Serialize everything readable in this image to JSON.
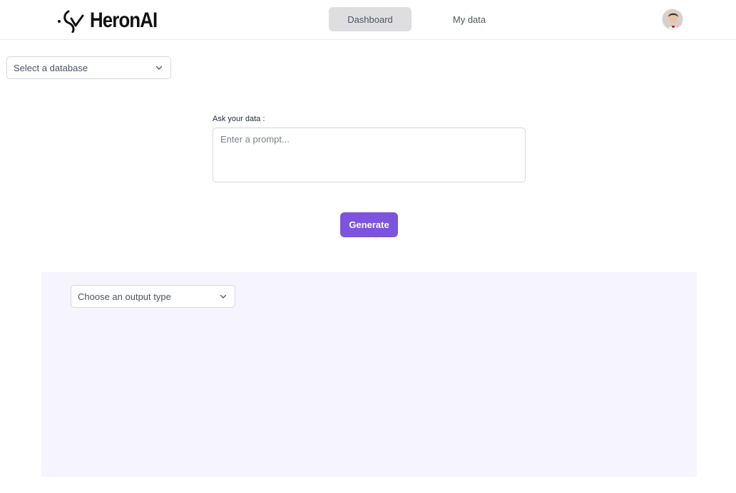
{
  "header": {
    "logo_text": "HeronAI",
    "nav": {
      "dashboard_label": "Dashboard",
      "my_data_label": "My data"
    },
    "active_tab": "Dashboard"
  },
  "database_select": {
    "placeholder": "Select a database"
  },
  "prompt": {
    "label": "Ask your data :",
    "placeholder": "Enter a prompt...",
    "value": ""
  },
  "generate_button": {
    "label": "Generate"
  },
  "output": {
    "type_select_placeholder": "Choose an output type"
  },
  "icons": {
    "logo": "heron-logo-icon",
    "avatar": "user-avatar",
    "dropdown": "chevron-down-icon"
  },
  "colors": {
    "accent": "#7c54dd",
    "active_nav_bg": "#dedee0",
    "output_panel_bg": "#f6f4fe"
  }
}
